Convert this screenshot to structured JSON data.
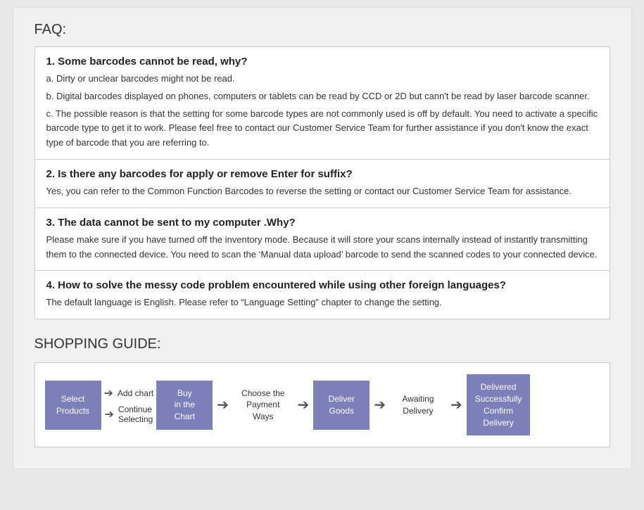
{
  "faq": {
    "title": "FAQ:",
    "items": [
      {
        "question": "1. Some barcodes cannot be read, why?",
        "answers": [
          "a. Dirty or unclear barcodes might not be read.",
          "b. Digital barcodes displayed on phones, computers or tablets can be read by CCD or 2D but cann't  be read by laser barcode scanner.",
          "c. The possible reason is that the setting for some barcode types are not commonly used is off by default. You need to activate a specific barcode type to get it to work. Please feel free to contact our Customer Service Team for further assistance if you don't know the exact type of barcode that you are referring to."
        ]
      },
      {
        "question": "2. Is there any barcodes for apply or remove Enter for suffix?",
        "answers": [
          "Yes, you can refer to the Common Function Barcodes to reverse the setting or contact our Customer Service Team for assistance."
        ]
      },
      {
        "question": "3. The data cannot be sent to my computer .Why?",
        "answers": [
          "Please make sure if you have turned off the inventory mode. Because it will store your scans internally instead of instantly transmitting them to the connected device. You need to scan the ‘Manual data upload’ barcode to send the scanned codes to your connected device."
        ]
      },
      {
        "question": "4. How to solve the messy code problem encountered while using other foreign languages?",
        "answers": [
          "The default language is English. Please refer to “Language Setting”  chapter to change the setting."
        ]
      }
    ]
  },
  "shopping_guide": {
    "title": "SHOPPING GUIDE:",
    "steps": [
      {
        "label": "Select\nProducts",
        "type": "colored"
      },
      {
        "sub": [
          "Add chart",
          "Continue\nSelecting"
        ],
        "type": "sub"
      },
      {
        "label": "Buy\nin the\nChart",
        "type": "colored"
      },
      {
        "label": "Choose the\nPayment\nWays",
        "type": "light"
      },
      {
        "label": "Deliver\nGoods",
        "type": "colored"
      },
      {
        "label": "Awaiting\nDelivery",
        "type": "light"
      },
      {
        "label": "Delivered\nSuccessfully\nConfirm\nDelivery",
        "type": "colored"
      }
    ]
  }
}
